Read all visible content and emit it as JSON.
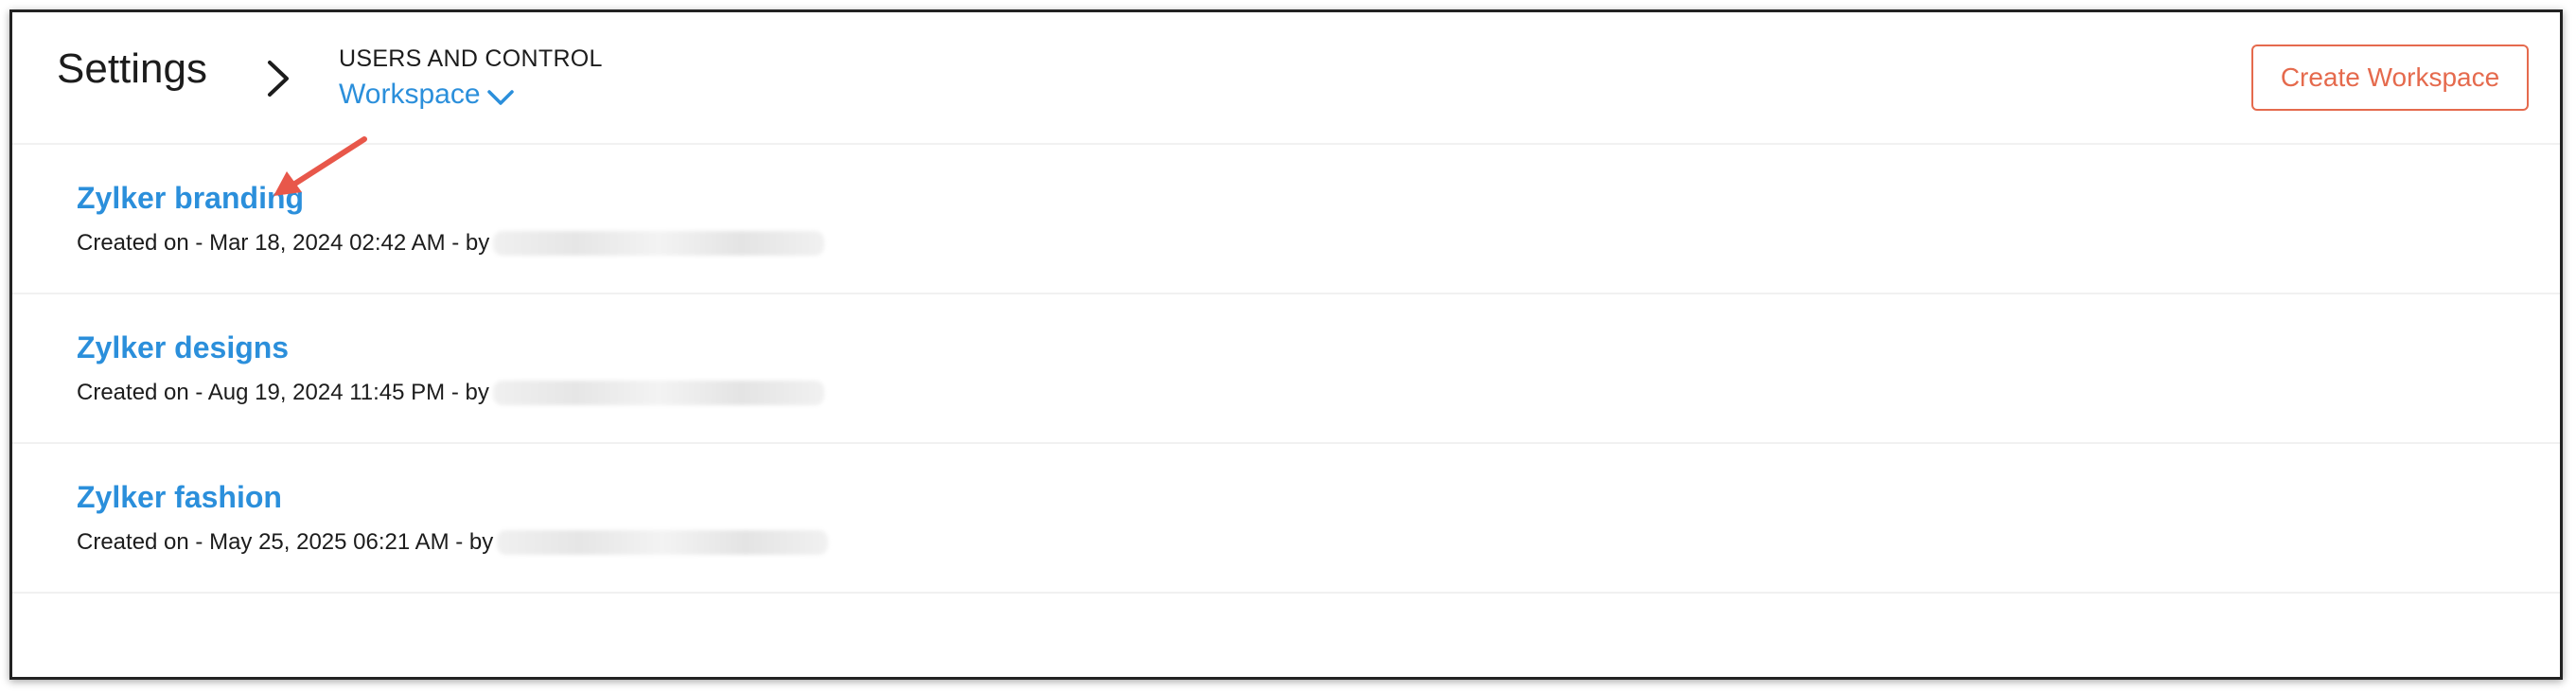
{
  "header": {
    "title": "Settings",
    "breadcrumb_parent": "USERS AND CONTROL",
    "workspace_selector_label": "Workspace",
    "create_button_label": "Create Workspace"
  },
  "workspaces": [
    {
      "name": "Zylker branding",
      "meta": "Created on - Mar 18, 2024 02:42 AM - by"
    },
    {
      "name": "Zylker designs",
      "meta": "Created on - Aug 19, 2024 11:45 PM - by"
    },
    {
      "name": "Zylker fashion",
      "meta": "Created on - May 25, 2025 06:21 AM - by"
    }
  ],
  "colors": {
    "link_blue": "#2b8fdb",
    "accent_orange": "#e56a4d",
    "annotation_red": "#e8574a"
  },
  "icons": {
    "breadcrumb_separator": "chevron-right-icon",
    "workspace_dropdown": "chevron-down-icon",
    "annotation": "arrow-annotation-icon"
  }
}
